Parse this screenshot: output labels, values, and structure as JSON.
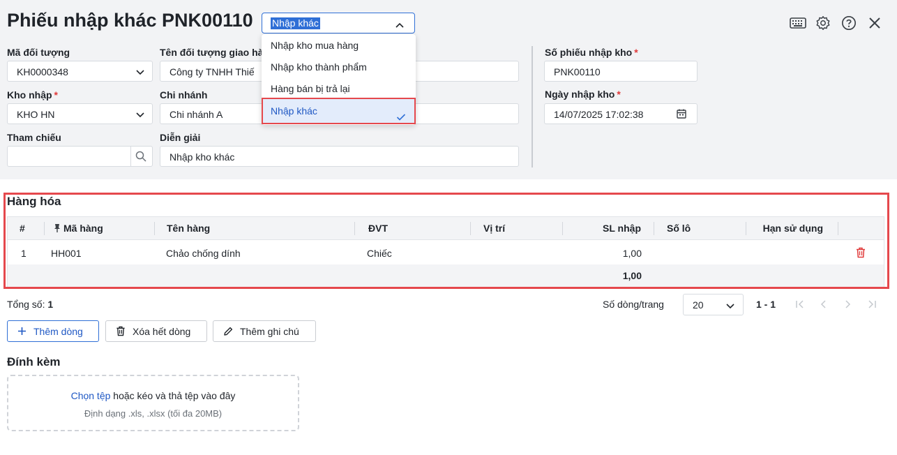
{
  "header": {
    "title": "Phiếu nhập khác PNK00110",
    "type_select_value": "Nhập khác",
    "icons": [
      "keyboard-icon",
      "gear-icon",
      "help-icon",
      "close-icon"
    ]
  },
  "type_dropdown": {
    "options": [
      "Nhập kho mua hàng",
      "Nhập kho thành phẩm",
      "Hàng bán bị trả lại",
      "Nhập khác"
    ],
    "selected_index": 3
  },
  "form": {
    "ma_doi_tuong": {
      "label": "Mã đối tượng",
      "value": "KH0000348"
    },
    "ten_doi_tuong": {
      "label": "Tên đối tượng giao hà",
      "value": "Công ty TNHH Thiế"
    },
    "kho_nhap": {
      "label": "Kho nhập",
      "value": "KHO HN",
      "required": "*"
    },
    "chi_nhanh": {
      "label": "Chi nhánh",
      "value": "Chi nhánh A"
    },
    "tham_chieu": {
      "label": "Tham chiếu",
      "value": ""
    },
    "dien_giai": {
      "label": "Diễn giải",
      "value": "Nhập kho khác"
    },
    "so_phieu": {
      "label": "Số phiếu nhập kho",
      "value": "PNK00110",
      "required": "*"
    },
    "ngay_nhap": {
      "label": "Ngày nhập kho",
      "value": "14/07/2025 17:02:38",
      "required": "*"
    }
  },
  "goods": {
    "title": "Hàng hóa",
    "columns": [
      "#",
      "Mã hàng",
      "Tên hàng",
      "ĐVT",
      "Vị trí",
      "SL nhập",
      "Số lô",
      "Hạn sử dụng"
    ],
    "rows": [
      {
        "index": "1",
        "ma_hang": "HH001",
        "ten_hang": "Chảo chống dính",
        "dvt": "Chiếc",
        "vi_tri": "",
        "sl_nhap": "1,00",
        "so_lo": "",
        "han_su_dung": ""
      }
    ],
    "total_sl": "1,00"
  },
  "pager": {
    "total_label": "Tổng số:",
    "total_value": "1",
    "rows_per_page_label": "Số dòng/trang",
    "rows_per_page": "20",
    "range": "1 - 1"
  },
  "actions": {
    "add_row": "Thêm dòng",
    "delete_all": "Xóa hết dòng",
    "add_note": "Thêm ghi chú"
  },
  "attachments": {
    "title": "Đính kèm",
    "choose_file": "Chọn tệp",
    "drop_text": "hoặc kéo và thả tệp vào đây",
    "format_hint": "Định dạng .xls, .xlsx (tối đa 20MB)"
  },
  "colors": {
    "accent": "#2f6fd6",
    "highlight": "#e5484d",
    "panel_bg": "#f2f3f5"
  }
}
